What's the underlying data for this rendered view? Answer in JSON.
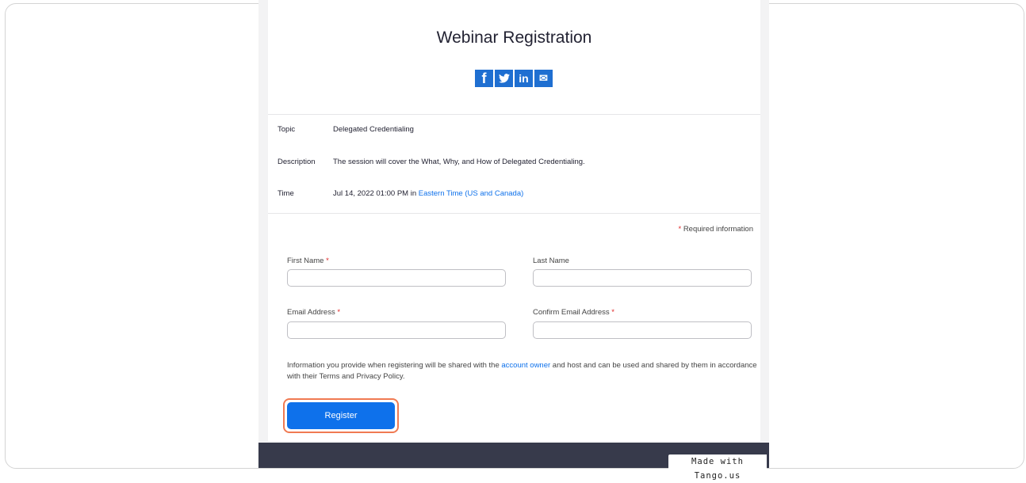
{
  "header": {
    "title": "Webinar Registration",
    "social": [
      {
        "icon": "facebook-icon",
        "glyph": "f"
      },
      {
        "icon": "twitter-icon",
        "glyph": "t"
      },
      {
        "icon": "linkedin-icon",
        "glyph": "in"
      },
      {
        "icon": "email-icon",
        "glyph": "✉"
      }
    ]
  },
  "details": {
    "topic_label": "Topic",
    "topic_value": "Delegated Credentialing",
    "description_label": "Description",
    "description_value": "The session will cover the What, Why, and How of Delegated Credentialing.",
    "time_label": "Time",
    "time_value": "Jul 14, 2022 01:00 PM in ",
    "time_zone_link": "Eastern Time (US and Canada)"
  },
  "form": {
    "required_star": "*",
    "required_note": "Required information",
    "first_name_label": "First Name",
    "last_name_label": "Last Name",
    "email_label": "Email Address",
    "confirm_email_label": "Confirm Email Address",
    "first_name_value": "",
    "last_name_value": "",
    "email_value": "",
    "confirm_email_value": "",
    "disclaimer_before": "Information you provide when registering will be shared with the ",
    "disclaimer_link": "account owner",
    "disclaimer_after": " and host and can be used and shared by them in accordance with their Terms and Privacy Policy.",
    "register_label": "Register"
  },
  "footer": {
    "tango_badge": "Made with Tango.us"
  },
  "colors": {
    "accent": "#0e71eb",
    "highlight": "#f07a52",
    "footer": "#373a4b"
  }
}
